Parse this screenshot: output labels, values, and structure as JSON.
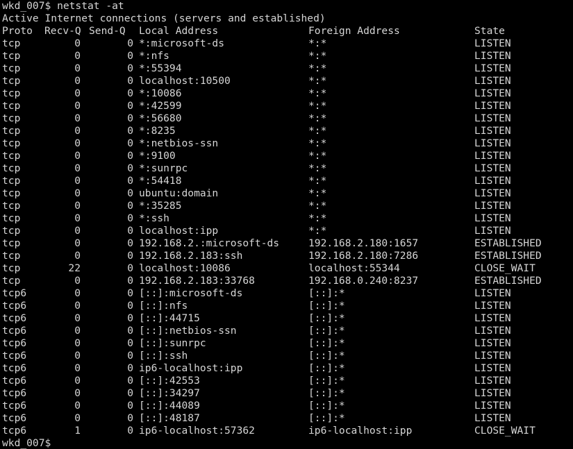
{
  "terminal": {
    "prompt": "wkd_007$",
    "command": "netstat -at",
    "command_line": "wkd_007$ netstat -at",
    "banner": "Active Internet connections (servers and established)",
    "final_prompt": "wkd_007$",
    "colors": {
      "background": "#000000",
      "foreground": "#d6d6d6"
    }
  },
  "table": {
    "headers": {
      "proto": "Proto",
      "recvq": "Recv-Q",
      "sendq": "Send-Q",
      "local": "Local Address",
      "foreign": "Foreign Address",
      "state": "State"
    },
    "rows": [
      {
        "proto": "tcp",
        "recvq": "0",
        "sendq": "0",
        "local": "*:microsoft-ds",
        "foreign": "*:*",
        "state": "LISTEN"
      },
      {
        "proto": "tcp",
        "recvq": "0",
        "sendq": "0",
        "local": "*:nfs",
        "foreign": "*:*",
        "state": "LISTEN"
      },
      {
        "proto": "tcp",
        "recvq": "0",
        "sendq": "0",
        "local": "*:55394",
        "foreign": "*:*",
        "state": "LISTEN"
      },
      {
        "proto": "tcp",
        "recvq": "0",
        "sendq": "0",
        "local": "localhost:10500",
        "foreign": "*:*",
        "state": "LISTEN"
      },
      {
        "proto": "tcp",
        "recvq": "0",
        "sendq": "0",
        "local": "*:10086",
        "foreign": "*:*",
        "state": "LISTEN"
      },
      {
        "proto": "tcp",
        "recvq": "0",
        "sendq": "0",
        "local": "*:42599",
        "foreign": "*:*",
        "state": "LISTEN"
      },
      {
        "proto": "tcp",
        "recvq": "0",
        "sendq": "0",
        "local": "*:56680",
        "foreign": "*:*",
        "state": "LISTEN"
      },
      {
        "proto": "tcp",
        "recvq": "0",
        "sendq": "0",
        "local": "*:8235",
        "foreign": "*:*",
        "state": "LISTEN"
      },
      {
        "proto": "tcp",
        "recvq": "0",
        "sendq": "0",
        "local": "*:netbios-ssn",
        "foreign": "*:*",
        "state": "LISTEN"
      },
      {
        "proto": "tcp",
        "recvq": "0",
        "sendq": "0",
        "local": "*:9100",
        "foreign": "*:*",
        "state": "LISTEN"
      },
      {
        "proto": "tcp",
        "recvq": "0",
        "sendq": "0",
        "local": "*:sunrpc",
        "foreign": "*:*",
        "state": "LISTEN"
      },
      {
        "proto": "tcp",
        "recvq": "0",
        "sendq": "0",
        "local": "*:54418",
        "foreign": "*:*",
        "state": "LISTEN"
      },
      {
        "proto": "tcp",
        "recvq": "0",
        "sendq": "0",
        "local": "ubuntu:domain",
        "foreign": "*:*",
        "state": "LISTEN"
      },
      {
        "proto": "tcp",
        "recvq": "0",
        "sendq": "0",
        "local": "*:35285",
        "foreign": "*:*",
        "state": "LISTEN"
      },
      {
        "proto": "tcp",
        "recvq": "0",
        "sendq": "0",
        "local": "*:ssh",
        "foreign": "*:*",
        "state": "LISTEN"
      },
      {
        "proto": "tcp",
        "recvq": "0",
        "sendq": "0",
        "local": "localhost:ipp",
        "foreign": "*:*",
        "state": "LISTEN"
      },
      {
        "proto": "tcp",
        "recvq": "0",
        "sendq": "0",
        "local": "192.168.2.:microsoft-ds",
        "foreign": "192.168.2.180:1657",
        "state": "ESTABLISHED"
      },
      {
        "proto": "tcp",
        "recvq": "0",
        "sendq": "0",
        "local": "192.168.2.183:ssh",
        "foreign": "192.168.2.180:7286",
        "state": "ESTABLISHED"
      },
      {
        "proto": "tcp",
        "recvq": "22",
        "sendq": "0",
        "local": "localhost:10086",
        "foreign": "localhost:55344",
        "state": "CLOSE_WAIT"
      },
      {
        "proto": "tcp",
        "recvq": "0",
        "sendq": "0",
        "local": "192.168.2.183:33768",
        "foreign": "192.168.0.240:8237",
        "state": "ESTABLISHED"
      },
      {
        "proto": "tcp6",
        "recvq": "0",
        "sendq": "0",
        "local": "[::]:microsoft-ds",
        "foreign": "[::]:*",
        "state": "LISTEN"
      },
      {
        "proto": "tcp6",
        "recvq": "0",
        "sendq": "0",
        "local": "[::]:nfs",
        "foreign": "[::]:*",
        "state": "LISTEN"
      },
      {
        "proto": "tcp6",
        "recvq": "0",
        "sendq": "0",
        "local": "[::]:44715",
        "foreign": "[::]:*",
        "state": "LISTEN"
      },
      {
        "proto": "tcp6",
        "recvq": "0",
        "sendq": "0",
        "local": "[::]:netbios-ssn",
        "foreign": "[::]:*",
        "state": "LISTEN"
      },
      {
        "proto": "tcp6",
        "recvq": "0",
        "sendq": "0",
        "local": "[::]:sunrpc",
        "foreign": "[::]:*",
        "state": "LISTEN"
      },
      {
        "proto": "tcp6",
        "recvq": "0",
        "sendq": "0",
        "local": "[::]:ssh",
        "foreign": "[::]:*",
        "state": "LISTEN"
      },
      {
        "proto": "tcp6",
        "recvq": "0",
        "sendq": "0",
        "local": "ip6-localhost:ipp",
        "foreign": "[::]:*",
        "state": "LISTEN"
      },
      {
        "proto": "tcp6",
        "recvq": "0",
        "sendq": "0",
        "local": "[::]:42553",
        "foreign": "[::]:*",
        "state": "LISTEN"
      },
      {
        "proto": "tcp6",
        "recvq": "0",
        "sendq": "0",
        "local": "[::]:34297",
        "foreign": "[::]:*",
        "state": "LISTEN"
      },
      {
        "proto": "tcp6",
        "recvq": "0",
        "sendq": "0",
        "local": "[::]:44089",
        "foreign": "[::]:*",
        "state": "LISTEN"
      },
      {
        "proto": "tcp6",
        "recvq": "0",
        "sendq": "0",
        "local": "[::]:48187",
        "foreign": "[::]:*",
        "state": "LISTEN"
      },
      {
        "proto": "tcp6",
        "recvq": "1",
        "sendq": "0",
        "local": "ip6-localhost:57362",
        "foreign": "ip6-localhost:ipp",
        "state": "CLOSE_WAIT"
      }
    ]
  }
}
